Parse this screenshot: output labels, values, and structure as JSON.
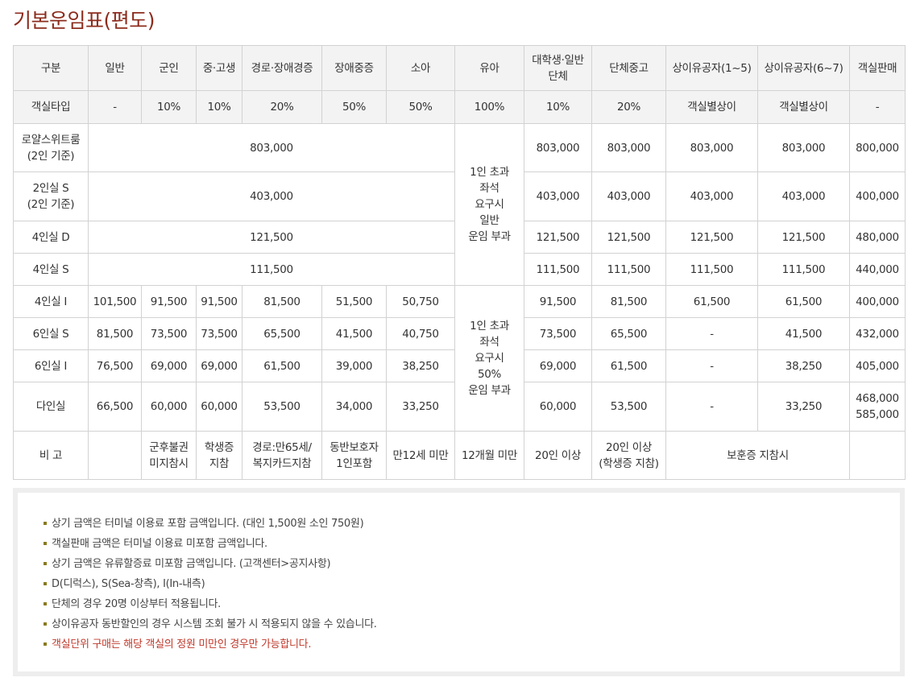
{
  "title": "기본운임표(편도)",
  "header": [
    "구분",
    "일반",
    "군인",
    "중·고생",
    "경로·장애경증",
    "장애중증",
    "소아",
    "유아",
    "대학생·일반\n단체",
    "단체중고",
    "상이유공자(1~5)",
    "상이유공자(6~7)",
    "객실판매"
  ],
  "subheader": [
    "객실타입",
    "-",
    "10%",
    "10%",
    "20%",
    "50%",
    "50%",
    "100%",
    "10%",
    "20%",
    "객실별상이",
    "객실별상이",
    "-"
  ],
  "rows": [
    {
      "label": "로얄스위트룸\n(2인 기준)",
      "merged": "803,000",
      "college": "803,000",
      "group": "803,000",
      "vet15": "803,000",
      "vet67": "803,000",
      "sale": "800,000"
    },
    {
      "label": "2인실 S\n(2인 기준)",
      "merged": "403,000",
      "college": "403,000",
      "group": "403,000",
      "vet15": "403,000",
      "vet67": "403,000",
      "sale": "400,000"
    },
    {
      "label": "4인실 D",
      "merged": "121,500",
      "college": "121,500",
      "group": "121,500",
      "vet15": "121,500",
      "vet67": "121,500",
      "sale": "480,000"
    },
    {
      "label": "4인실 S",
      "merged": "111,500",
      "college": "111,500",
      "group": "111,500",
      "vet15": "111,500",
      "vet67": "111,500",
      "sale": "440,000"
    },
    {
      "label": "4인실 I",
      "general": "101,500",
      "military": "91,500",
      "student": "91,500",
      "senior": "81,500",
      "disabled": "51,500",
      "child": "50,750",
      "college": "91,500",
      "group": "81,500",
      "vet15": "61,500",
      "vet67": "61,500",
      "sale": "400,000"
    },
    {
      "label": "6인실 S",
      "general": "81,500",
      "military": "73,500",
      "student": "73,500",
      "senior": "65,500",
      "disabled": "41,500",
      "child": "40,750",
      "college": "73,500",
      "group": "65,500",
      "vet15": "-",
      "vet67": "41,500",
      "sale": "432,000"
    },
    {
      "label": "6인실 I",
      "general": "76,500",
      "military": "69,000",
      "student": "69,000",
      "senior": "61,500",
      "disabled": "39,000",
      "child": "38,250",
      "college": "69,000",
      "group": "61,500",
      "vet15": "-",
      "vet67": "38,250",
      "sale": "405,000"
    },
    {
      "label": "다인실",
      "general": "66,500",
      "military": "60,000",
      "student": "60,000",
      "senior": "53,500",
      "disabled": "34,000",
      "child": "33,250",
      "college": "60,000",
      "group": "53,500",
      "vet15": "-",
      "vet67": "33,250",
      "sale": "468,000\n585,000"
    }
  ],
  "infant_note_top": "1인 초과\n좌석\n요구시\n일반\n운임 부과",
  "infant_note_bottom": "1인 초과\n좌석\n요구시\n50%\n운임 부과",
  "remarks": {
    "label": "비 고",
    "military": "군후불권\n미지참시",
    "student": "학생증\n지참",
    "senior": "경로:만65세/\n복지카드지참",
    "disabled": "동반보호자\n1인포함",
    "child": "만12세 미만",
    "infant": "12개월 미만",
    "college": "20인 이상",
    "group": "20인 이상\n(학생증 지참)",
    "veteran": "보훈증 지참시"
  },
  "notes": [
    "상기 금액은 터미널 이용료 포함 금액입니다. (대인 1,500원 소인 750원)",
    "객실판매 금액은 터미널 이용료 미포함 금액입니다.",
    "상기 금액은 유류할증료 미포함 금액입니다. (고객센터>공지사항)",
    "D(디럭스), S(Sea-창측), I(In-내측)",
    "단체의 경우 20명 이상부터 적용됩니다.",
    "상이유공자 동반할인의 경우 시스템 조회 불가 시 적용되지 않을 수 있습니다.",
    "객실단위 구매는 해당 객실의 정원 미만인 경우만 가능합니다."
  ],
  "colors": {
    "title": "#8c2c1d",
    "bullet": "#8a7a20",
    "highlight": "#c0392b"
  }
}
